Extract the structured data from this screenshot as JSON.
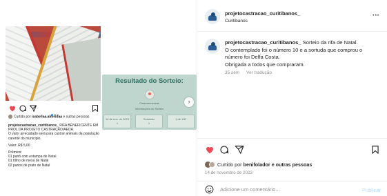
{
  "embedded_post": {
    "liked_by_prefix": "Curtido por",
    "liked_by_user": "isabellaa.almeidaa",
    "liked_by_suffix": "e outras pessoas",
    "username": "projetocastracao_curitibanos_",
    "caption_lines": [
      "RIFA BENEFICENTE EM PROL DA PROJETO CASTRAÇÃO/AEDA.",
      "O valor arrecadado será para castrar animais da população carente do município."
    ],
    "value_line": "Valor: R$ 5,00",
    "prizes_title": "Prêmios:",
    "prizes": [
      "01 panô com estampa de Natal",
      "01 trilho de mesa de Natal",
      "02 panos de prato de Natal"
    ]
  },
  "slide": {
    "title": "Resultado do Sorteio:",
    "subtitle": "Castraremessas",
    "caption": "Informações do Sorteio",
    "boxes": [
      {
        "top": "14 de nov. de 2023",
        "bottom": "1"
      },
      {
        "top": "Sorteado",
        "bottom": "1"
      },
      {
        "top": "1 de 100",
        "bottom": ""
      }
    ],
    "nav_next": "›"
  },
  "post": {
    "username": "projetocastracao_curitibanos_",
    "location": "Curitibanos",
    "more": "···",
    "caption": {
      "username": "projetocastracao_curitibanos_",
      "lines": [
        "Sorteio da rifa de Natal.",
        "O contemplado foi o número 10 e a sortuda que comprou o número foi Delfa Costa.",
        "Obrigada a todos que compraram."
      ],
      "age": "35 sem",
      "translate": "Ver tradução"
    },
    "liked_by_prefix": "Curtido por",
    "liked_by_user": "benifolador",
    "liked_by_suffix": "e outras pessoas",
    "date": "14 de novembro de 2023",
    "comment_placeholder": "Adicione um comentário...",
    "publish": "Publicar"
  },
  "colors": {
    "like_red": "#ed4956",
    "link_blue": "#0095f6",
    "publish_disabled": "#b3dbff",
    "muted": "#8e8e8e"
  },
  "icons": [
    "heart-icon",
    "comment-icon",
    "share-icon",
    "bookmark-icon",
    "emoji-icon",
    "more-icon",
    "chevron-right-icon"
  ]
}
